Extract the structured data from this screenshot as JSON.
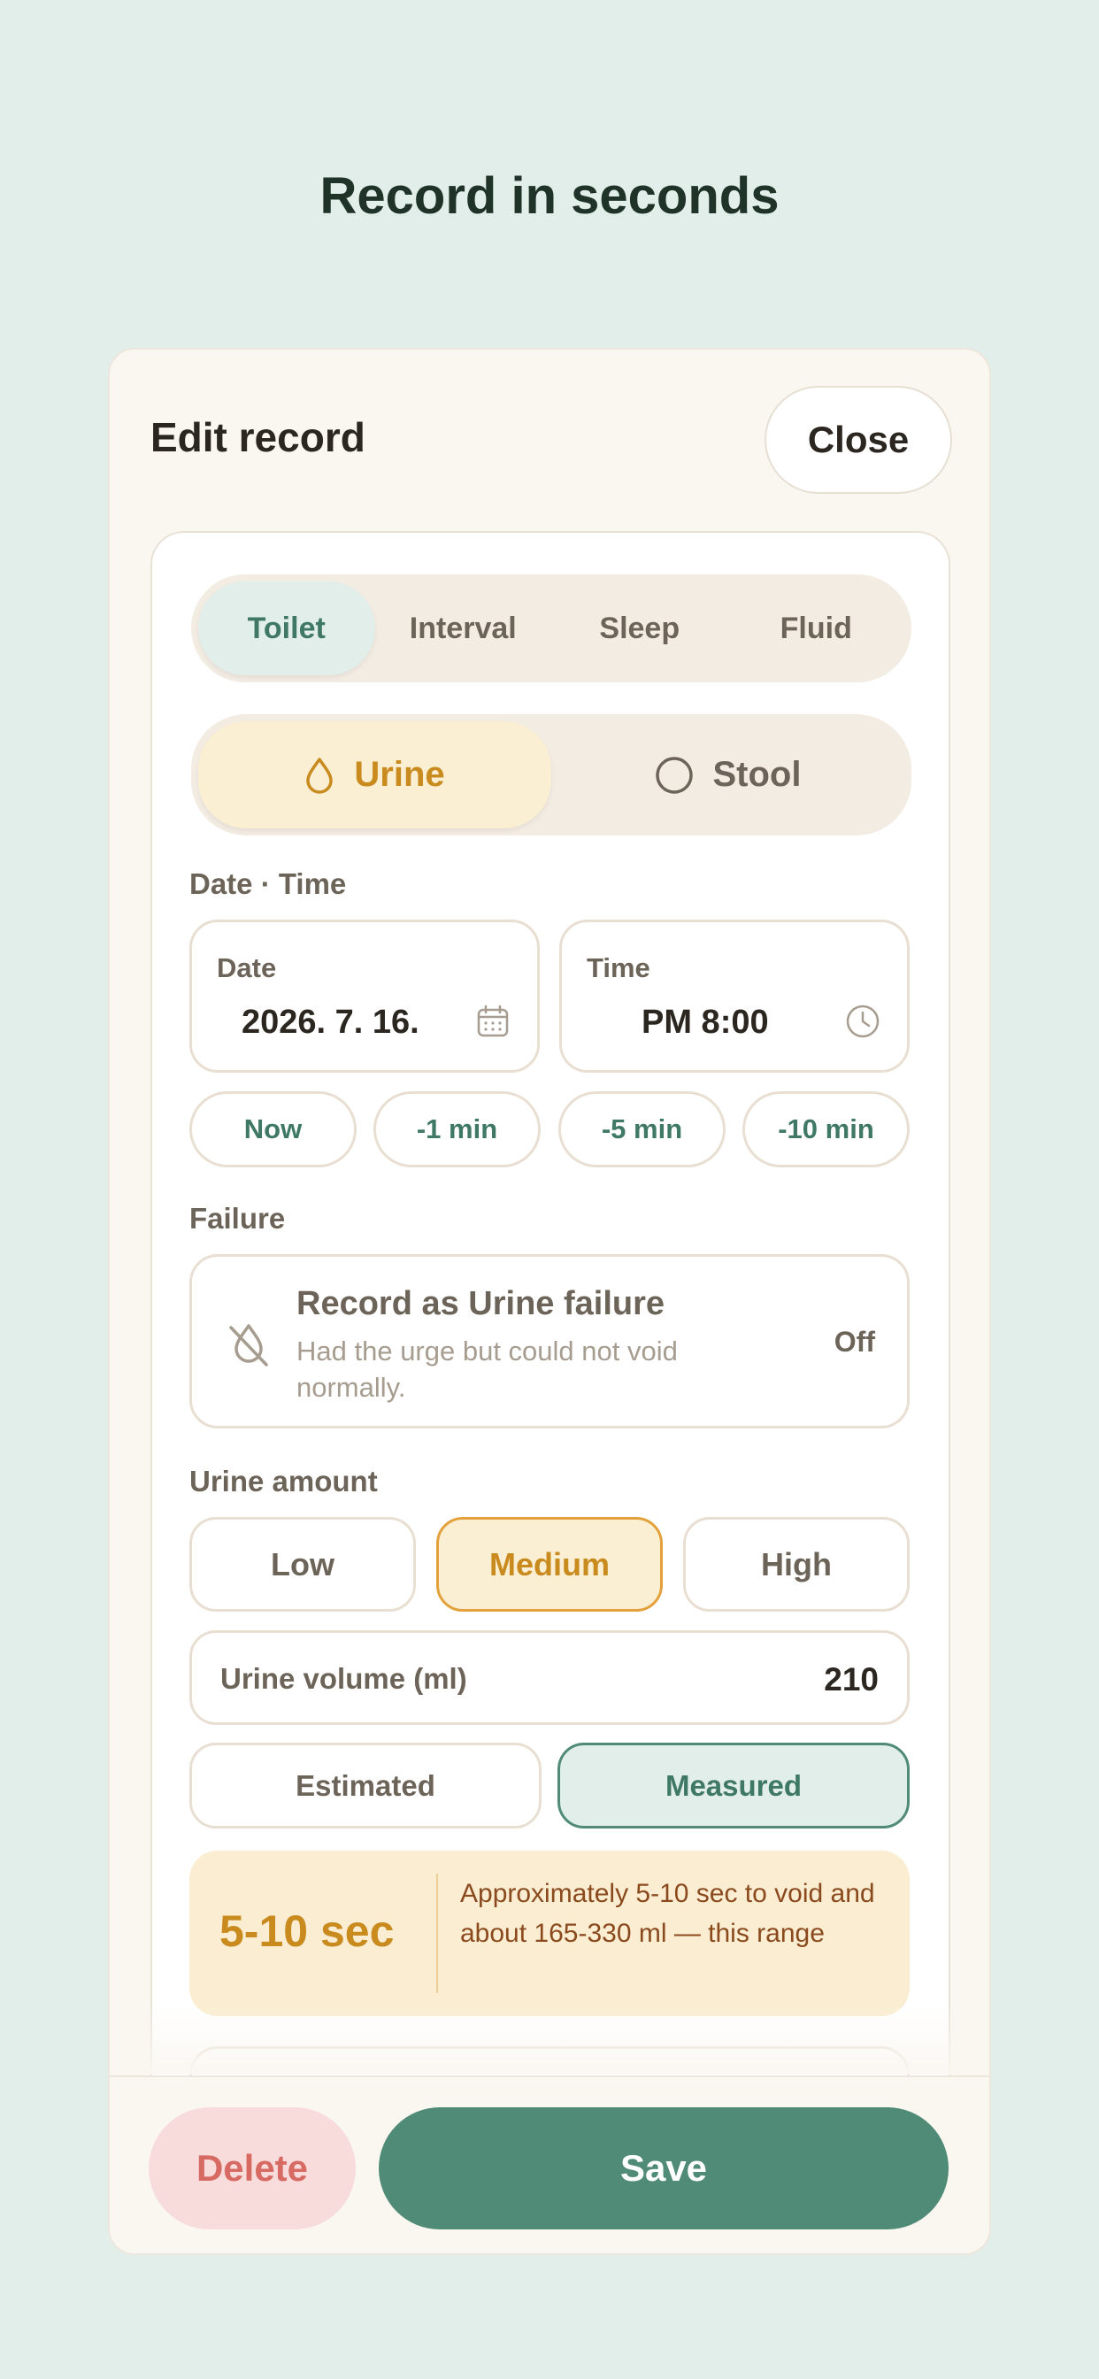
{
  "headline": "Record in seconds",
  "sheet": {
    "title": "Edit record",
    "close_label": "Close"
  },
  "tabs": [
    {
      "label": "Toilet",
      "active": true
    },
    {
      "label": "Interval",
      "active": false
    },
    {
      "label": "Sleep",
      "active": false
    },
    {
      "label": "Fluid",
      "active": false
    }
  ],
  "kind_toggle": [
    {
      "label": "Urine",
      "icon": "drop-icon",
      "active": true
    },
    {
      "label": "Stool",
      "icon": "circle-icon",
      "active": false
    }
  ],
  "datetime": {
    "section_label": "Date · Time",
    "date_label": "Date",
    "date_value": "2026. 7. 16.",
    "date_icon": "calendar-icon",
    "time_label": "Time",
    "time_value": "PM 8:00",
    "time_icon": "clock-icon",
    "quick_buttons": [
      "Now",
      "-1 min",
      "-5 min",
      "-10 min"
    ]
  },
  "failure": {
    "section_label": "Failure",
    "icon": "no-drop-icon",
    "title": "Record as Urine failure",
    "description": "Had the urge but could not void normally.",
    "state": "Off"
  },
  "amount": {
    "section_label": "Urine amount",
    "options": [
      "Low",
      "Medium",
      "High"
    ],
    "selected": "Medium",
    "volume_label": "Urine volume (ml)",
    "volume_value": "210",
    "modes": [
      "Estimated",
      "Measured"
    ],
    "selected_mode": "Measured"
  },
  "info": {
    "duration": "5-10 sec",
    "text": "Approximately 5-10 sec to void and about 165-330 ml — this range"
  },
  "footer": {
    "delete_label": "Delete",
    "save_label": "Save"
  },
  "colors": {
    "accent_green": "#4f8b76",
    "accent_amber": "#c98a1e",
    "danger": "#d76a62",
    "background": "#e2eee9"
  }
}
